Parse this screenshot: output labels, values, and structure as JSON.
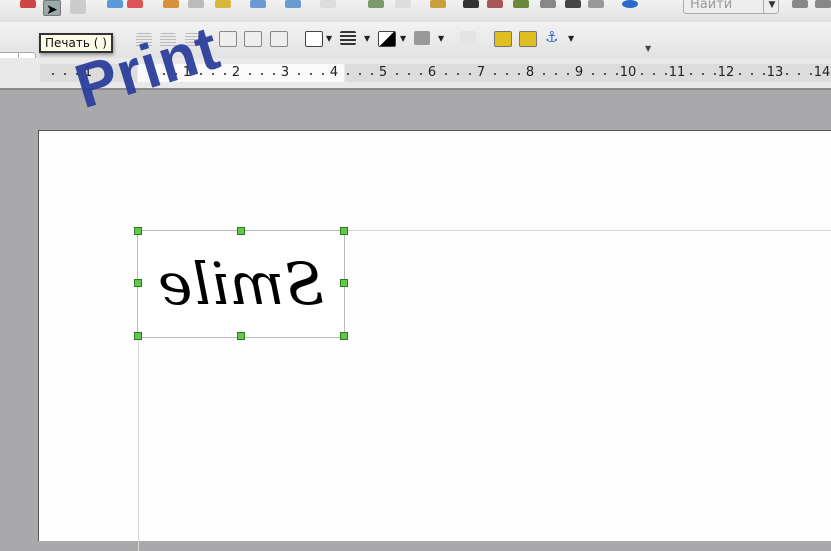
{
  "toolbar": {
    "search_placeholder": "Найти",
    "tooltip": "Печать ( )"
  },
  "ruler": {
    "labels": [
      "1",
      "1",
      "2",
      "3",
      "4",
      "5",
      "6",
      "7",
      "8",
      "9",
      "10",
      "11",
      "12",
      "13",
      "14"
    ]
  },
  "image": {
    "text": "Smile"
  },
  "overlay": {
    "watermark": "Print"
  },
  "colors": {
    "handle": "#5fc94a",
    "watermark": "#2d3f9c"
  }
}
